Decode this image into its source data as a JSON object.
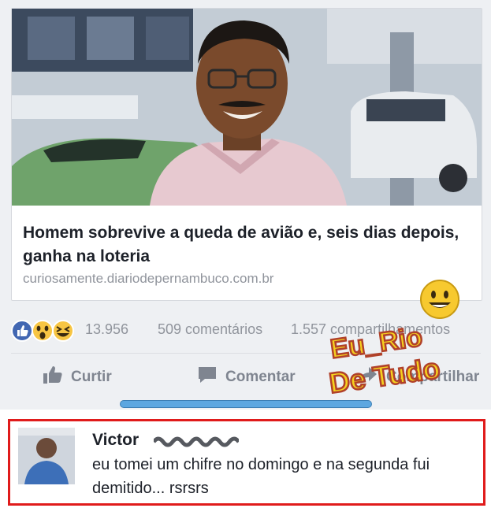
{
  "post": {
    "headline": "Homem sobrevive a queda de avião e, seis dias depois, ganha na loteria",
    "domain": "curiosamente.diariodepernambuco.com.br"
  },
  "reactions": {
    "count": "13.956",
    "comments": "509 comentários",
    "shares": "1.557 compartilhamentos",
    "icons": [
      "like-icon",
      "wow-icon",
      "haha-icon"
    ]
  },
  "actions": {
    "like_label": "Curtir",
    "comment_label": "Comentar",
    "share_label": "Compartilhar"
  },
  "comment": {
    "author": "Victor",
    "text": "eu tomei um chifre no domingo e na segunda fui demitido... rsrsrs"
  },
  "watermark": {
    "line1": "Eu_Rio",
    "line2": "De Tudo"
  },
  "colors": {
    "highlight_border": "#e01b1b",
    "link_blue": "#4267b2",
    "muted_text": "#90949c"
  }
}
